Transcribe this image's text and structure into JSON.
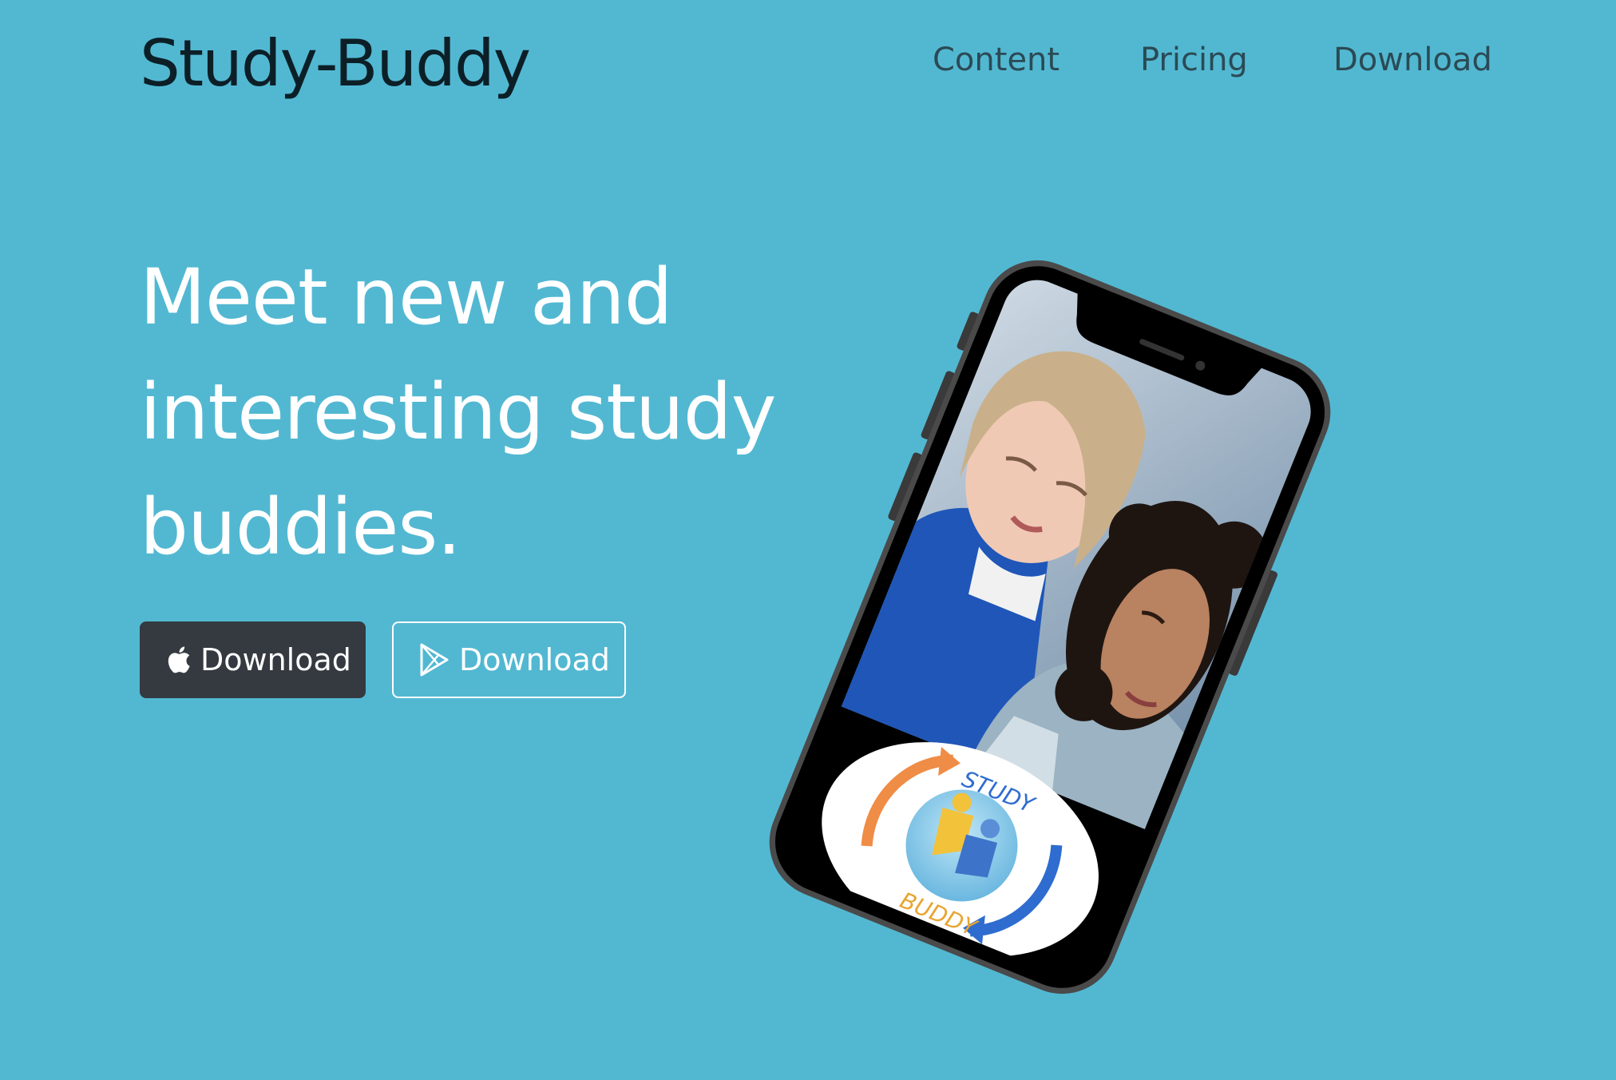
{
  "brand": {
    "name": "Study-Buddy"
  },
  "nav": {
    "content": "Content",
    "pricing": "Pricing",
    "download": "Download"
  },
  "hero": {
    "headline_line1": "Meet new and",
    "headline_line2": "interesting study",
    "headline_line3": "buddies."
  },
  "buttons": {
    "apple_label": "Download",
    "google_label": "Download"
  },
  "logo": {
    "top_text": "STUDY",
    "bottom_text": "BUDDY"
  },
  "colors": {
    "background": "#52b8d2",
    "apple_button": "#343a40",
    "phone_body": "#000000"
  }
}
